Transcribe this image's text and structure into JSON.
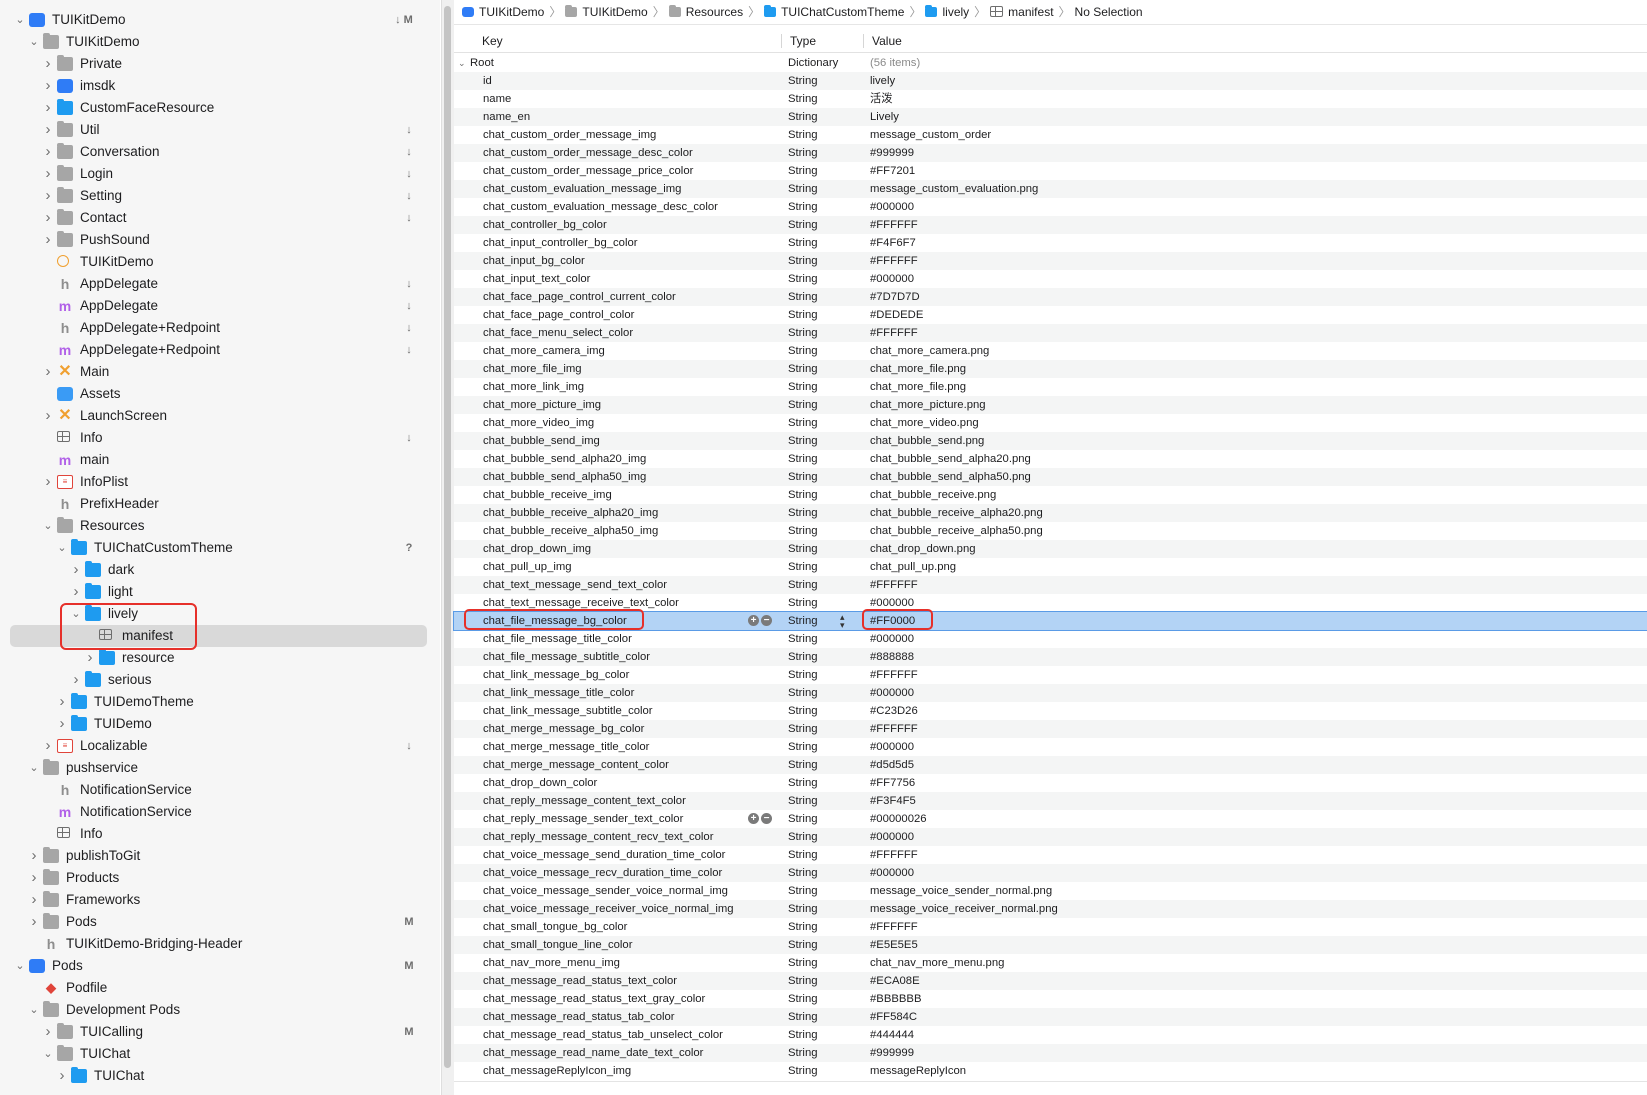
{
  "navigator": {
    "items": [
      {
        "label": "TUIKitDemo",
        "indent": 0,
        "chev": "down",
        "icon": "proj",
        "status": "↓ M"
      },
      {
        "label": "TUIKitDemo",
        "indent": 1,
        "chev": "down",
        "icon": "folder",
        "status": ""
      },
      {
        "label": "Private",
        "indent": 2,
        "chev": "right",
        "icon": "folder",
        "status": ""
      },
      {
        "label": "imsdk",
        "indent": 2,
        "chev": "right",
        "icon": "proj",
        "status": ""
      },
      {
        "label": "CustomFaceResource",
        "indent": 2,
        "chev": "right",
        "icon": "bfolder",
        "status": ""
      },
      {
        "label": "Util",
        "indent": 2,
        "chev": "right",
        "icon": "folder",
        "status": "↓"
      },
      {
        "label": "Conversation",
        "indent": 2,
        "chev": "right",
        "icon": "folder",
        "status": "↓"
      },
      {
        "label": "Login",
        "indent": 2,
        "chev": "right",
        "icon": "folder",
        "status": "↓"
      },
      {
        "label": "Setting",
        "indent": 2,
        "chev": "right",
        "icon": "folder",
        "status": "↓"
      },
      {
        "label": "Contact",
        "indent": 2,
        "chev": "right",
        "icon": "folder",
        "status": "↓"
      },
      {
        "label": "PushSound",
        "indent": 2,
        "chev": "right",
        "icon": "folder",
        "status": ""
      },
      {
        "label": "TUIKitDemo",
        "indent": 2,
        "chev": "",
        "icon": "gear",
        "status": ""
      },
      {
        "label": "AppDelegate",
        "indent": 2,
        "chev": "",
        "icon": "h",
        "status": "↓"
      },
      {
        "label": "AppDelegate",
        "indent": 2,
        "chev": "",
        "icon": "m",
        "status": "↓"
      },
      {
        "label": "AppDelegate+Redpoint",
        "indent": 2,
        "chev": "",
        "icon": "h",
        "status": "↓"
      },
      {
        "label": "AppDelegate+Redpoint",
        "indent": 2,
        "chev": "",
        "icon": "m",
        "status": "↓"
      },
      {
        "label": "Main",
        "indent": 2,
        "chev": "right",
        "icon": "x",
        "status": ""
      },
      {
        "label": "Assets",
        "indent": 2,
        "chev": "",
        "icon": "assets",
        "status": ""
      },
      {
        "label": "LaunchScreen",
        "indent": 2,
        "chev": "right",
        "icon": "x",
        "status": ""
      },
      {
        "label": "Info",
        "indent": 2,
        "chev": "",
        "icon": "plist",
        "status": "↓"
      },
      {
        "label": "main",
        "indent": 2,
        "chev": "",
        "icon": "m",
        "status": ""
      },
      {
        "label": "InfoPlist",
        "indent": 2,
        "chev": "right",
        "icon": "strings",
        "status": ""
      },
      {
        "label": "PrefixHeader",
        "indent": 2,
        "chev": "",
        "icon": "h",
        "status": ""
      },
      {
        "label": "Resources",
        "indent": 2,
        "chev": "down",
        "icon": "folder",
        "status": ""
      },
      {
        "label": "TUIChatCustomTheme",
        "indent": 3,
        "chev": "down",
        "icon": "bfolder",
        "status": "?"
      },
      {
        "label": "dark",
        "indent": 4,
        "chev": "right",
        "icon": "bfolder",
        "status": ""
      },
      {
        "label": "light",
        "indent": 4,
        "chev": "right",
        "icon": "bfolder",
        "status": ""
      },
      {
        "label": "lively",
        "indent": 4,
        "chev": "down",
        "icon": "bfolder",
        "status": ""
      },
      {
        "label": "manifest",
        "indent": 5,
        "chev": "",
        "icon": "plist",
        "status": "",
        "selected": true
      },
      {
        "label": "resource",
        "indent": 5,
        "chev": "right",
        "icon": "bfolder",
        "status": ""
      },
      {
        "label": "serious",
        "indent": 4,
        "chev": "right",
        "icon": "bfolder",
        "status": ""
      },
      {
        "label": "TUIDemoTheme",
        "indent": 3,
        "chev": "right",
        "icon": "bfolder",
        "status": ""
      },
      {
        "label": "TUIDemo",
        "indent": 3,
        "chev": "right",
        "icon": "bfolder",
        "status": ""
      },
      {
        "label": "Localizable",
        "indent": 2,
        "chev": "right",
        "icon": "strings",
        "status": "↓"
      },
      {
        "label": "pushservice",
        "indent": 1,
        "chev": "down",
        "icon": "folder",
        "status": ""
      },
      {
        "label": "NotificationService",
        "indent": 2,
        "chev": "",
        "icon": "h",
        "status": ""
      },
      {
        "label": "NotificationService",
        "indent": 2,
        "chev": "",
        "icon": "m",
        "status": ""
      },
      {
        "label": "Info",
        "indent": 2,
        "chev": "",
        "icon": "plist",
        "status": ""
      },
      {
        "label": "publishToGit",
        "indent": 1,
        "chev": "right",
        "icon": "folder",
        "status": ""
      },
      {
        "label": "Products",
        "indent": 1,
        "chev": "right",
        "icon": "folder",
        "status": ""
      },
      {
        "label": "Frameworks",
        "indent": 1,
        "chev": "right",
        "icon": "folder",
        "status": ""
      },
      {
        "label": "Pods",
        "indent": 1,
        "chev": "right",
        "icon": "folder",
        "status": "M"
      },
      {
        "label": "TUIKitDemo-Bridging-Header",
        "indent": 1,
        "chev": "",
        "icon": "h",
        "status": ""
      },
      {
        "label": "Pods",
        "indent": 0,
        "chev": "down",
        "icon": "proj",
        "status": "M"
      },
      {
        "label": "Podfile",
        "indent": 1,
        "chev": "",
        "icon": "ruby",
        "status": ""
      },
      {
        "label": "Development Pods",
        "indent": 1,
        "chev": "down",
        "icon": "folder",
        "status": ""
      },
      {
        "label": "TUICalling",
        "indent": 2,
        "chev": "right",
        "icon": "folder",
        "status": "M"
      },
      {
        "label": "TUIChat",
        "indent": 2,
        "chev": "down",
        "icon": "folder",
        "status": ""
      },
      {
        "label": "TUIChat",
        "indent": 3,
        "chev": "right",
        "icon": "bfolder",
        "status": ""
      }
    ]
  },
  "breadcrumb": [
    {
      "label": "TUIKitDemo",
      "icon": "proj"
    },
    {
      "label": "TUIKitDemo",
      "icon": "folder"
    },
    {
      "label": "Resources",
      "icon": "folder"
    },
    {
      "label": "TUIChatCustomTheme",
      "icon": "bfolder"
    },
    {
      "label": "lively",
      "icon": "bfolder"
    },
    {
      "label": "manifest",
      "icon": "plist"
    },
    {
      "label": "No Selection",
      "icon": ""
    }
  ],
  "plist": {
    "columns": {
      "key": "Key",
      "type": "Type",
      "value": "Value"
    },
    "root": {
      "key": "Root",
      "type": "Dictionary",
      "value": "(56 items)"
    },
    "rows": [
      [
        "id",
        "String",
        "lively"
      ],
      [
        "name",
        "String",
        "活泼"
      ],
      [
        "name_en",
        "String",
        "Lively"
      ],
      [
        "chat_custom_order_message_img",
        "String",
        "message_custom_order"
      ],
      [
        "chat_custom_order_message_desc_color",
        "String",
        "#999999"
      ],
      [
        "chat_custom_order_message_price_color",
        "String",
        "#FF7201"
      ],
      [
        "chat_custom_evaluation_message_img",
        "String",
        "message_custom_evaluation.png"
      ],
      [
        "chat_custom_evaluation_message_desc_color",
        "String",
        "#000000"
      ],
      [
        "chat_controller_bg_color",
        "String",
        "#FFFFFF"
      ],
      [
        "chat_input_controller_bg_color",
        "String",
        "#F4F6F7"
      ],
      [
        "chat_input_bg_color",
        "String",
        "#FFFFFF"
      ],
      [
        "chat_input_text_color",
        "String",
        "#000000"
      ],
      [
        "chat_face_page_control_current_color",
        "String",
        "#7D7D7D"
      ],
      [
        "chat_face_page_control_color",
        "String",
        "#DEDEDE"
      ],
      [
        "chat_face_menu_select_color",
        "String",
        "#FFFFFF"
      ],
      [
        "chat_more_camera_img",
        "String",
        "chat_more_camera.png"
      ],
      [
        "chat_more_file_img",
        "String",
        "chat_more_file.png"
      ],
      [
        "chat_more_link_img",
        "String",
        "chat_more_file.png"
      ],
      [
        "chat_more_picture_img",
        "String",
        "chat_more_picture.png"
      ],
      [
        "chat_more_video_img",
        "String",
        "chat_more_video.png"
      ],
      [
        "chat_bubble_send_img",
        "String",
        "chat_bubble_send.png"
      ],
      [
        "chat_bubble_send_alpha20_img",
        "String",
        "chat_bubble_send_alpha20.png"
      ],
      [
        "chat_bubble_send_alpha50_img",
        "String",
        "chat_bubble_send_alpha50.png"
      ],
      [
        "chat_bubble_receive_img",
        "String",
        "chat_bubble_receive.png"
      ],
      [
        "chat_bubble_receive_alpha20_img",
        "String",
        "chat_bubble_receive_alpha20.png"
      ],
      [
        "chat_bubble_receive_alpha50_img",
        "String",
        "chat_bubble_receive_alpha50.png"
      ],
      [
        "chat_drop_down_img",
        "String",
        "chat_drop_down.png"
      ],
      [
        "chat_pull_up_img",
        "String",
        "chat_pull_up.png"
      ],
      [
        "chat_text_message_send_text_color",
        "String",
        "#FFFFFF"
      ],
      [
        "chat_text_message_receive_text_color",
        "String",
        "#000000"
      ],
      [
        "chat_file_message_bg_color",
        "String",
        "#FF0000"
      ],
      [
        "chat_file_message_title_color",
        "String",
        "#000000"
      ],
      [
        "chat_file_message_subtitle_color",
        "String",
        "#888888"
      ],
      [
        "chat_link_message_bg_color",
        "String",
        "#FFFFFF"
      ],
      [
        "chat_link_message_title_color",
        "String",
        "#000000"
      ],
      [
        "chat_link_message_subtitle_color",
        "String",
        "#C23D26"
      ],
      [
        "chat_merge_message_bg_color",
        "String",
        "#FFFFFF"
      ],
      [
        "chat_merge_message_title_color",
        "String",
        "#000000"
      ],
      [
        "chat_merge_message_content_color",
        "String",
        "#d5d5d5"
      ],
      [
        "chat_drop_down_color",
        "String",
        "#FF7756"
      ],
      [
        "chat_reply_message_content_text_color",
        "String",
        "#F3F4F5"
      ],
      [
        "chat_reply_message_sender_text_color",
        "String",
        "#00000026"
      ],
      [
        "chat_reply_message_content_recv_text_color",
        "String",
        "#000000"
      ],
      [
        "chat_voice_message_send_duration_time_color",
        "String",
        "#FFFFFF"
      ],
      [
        "chat_voice_message_recv_duration_time_color",
        "String",
        "#000000"
      ],
      [
        "chat_voice_message_sender_voice_normal_img",
        "String",
        "message_voice_sender_normal.png"
      ],
      [
        "chat_voice_message_receiver_voice_normal_img",
        "String",
        "message_voice_receiver_normal.png"
      ],
      [
        "chat_small_tongue_bg_color",
        "String",
        "#FFFFFF"
      ],
      [
        "chat_small_tongue_line_color",
        "String",
        "#E5E5E5"
      ],
      [
        "chat_nav_more_menu_img",
        "String",
        "chat_nav_more_menu.png"
      ],
      [
        "chat_message_read_status_text_color",
        "String",
        "#ECA08E"
      ],
      [
        "chat_message_read_status_text_gray_color",
        "String",
        "#BBBBBB"
      ],
      [
        "chat_message_read_status_tab_color",
        "String",
        "#FF584C"
      ],
      [
        "chat_message_read_status_tab_unselect_color",
        "String",
        "#444444"
      ],
      [
        "chat_message_read_name_date_text_color",
        "String",
        "#999999"
      ],
      [
        "chat_messageReplyIcon_img",
        "String",
        "messageReplyIcon"
      ]
    ],
    "selected_row": 30,
    "hover_row": 41
  },
  "accent": {
    "highlight": "#e6302a",
    "selection": "#b3d3f5"
  }
}
